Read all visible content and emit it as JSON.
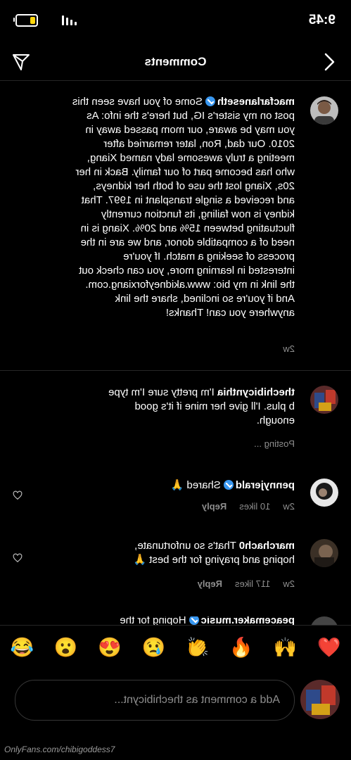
{
  "status_bar": {
    "time": "9:45",
    "battery_level": 0.3
  },
  "header": {
    "title": "Comments"
  },
  "comments": [
    {
      "username": "macfarlaneseth",
      "verified": true,
      "lines": [
        "Some of you have seen this",
        "post on my sister's IG, but here's the info:  As",
        "you may be aware, our mom passed away in",
        "2010.  Our dad, Ron, later remarried after",
        "meeting a truly awesome lady named Xiang,",
        "who has become part of our family.  Back in her",
        "20s, Xiang lost the use of both her kidneys,",
        "and received a single transplant in 1997.  That",
        "kidney is now failing, its function currently",
        "fluctuating between 15% and 20%. Xiang is in",
        "need of a compatible donor, and we are in the",
        "process of seeking a match.  If you're",
        "interested in learning more, you can check out",
        "the link in my bio: www.akidneyforxiang.com.",
        "And if you're so inclined, share the link",
        "anywhere you can!  Thanks!"
      ],
      "time": "2w"
    },
    {
      "username": "thechibicynthia",
      "lines": [
        "I'm pretty sure I'm type",
        "b plus. I'll give her mine if it's good",
        "enough."
      ],
      "status": "Posting ..."
    },
    {
      "username": "pennyjerald",
      "verified": true,
      "text": "Shared 🙏",
      "time": "2w",
      "likes": "10 likes",
      "reply": "Reply"
    },
    {
      "username": "marchach0",
      "lines": [
        "That's so unfortunate,",
        "hoping and praying for the best 🙏"
      ],
      "time": "2w",
      "likes": "117 likes",
      "reply": "Reply"
    },
    {
      "username": "peacemaker.music",
      "verified": true,
      "text": "Hoping for the"
    }
  ],
  "emoji_bar": [
    "😂",
    "😮",
    "😍",
    "😢",
    "👏",
    "🔥",
    "🙌",
    "❤️"
  ],
  "input": {
    "placeholder": "Add a comment as thechibicynt..."
  },
  "watermark": "OnlyFans.com/chibigoddess7"
}
